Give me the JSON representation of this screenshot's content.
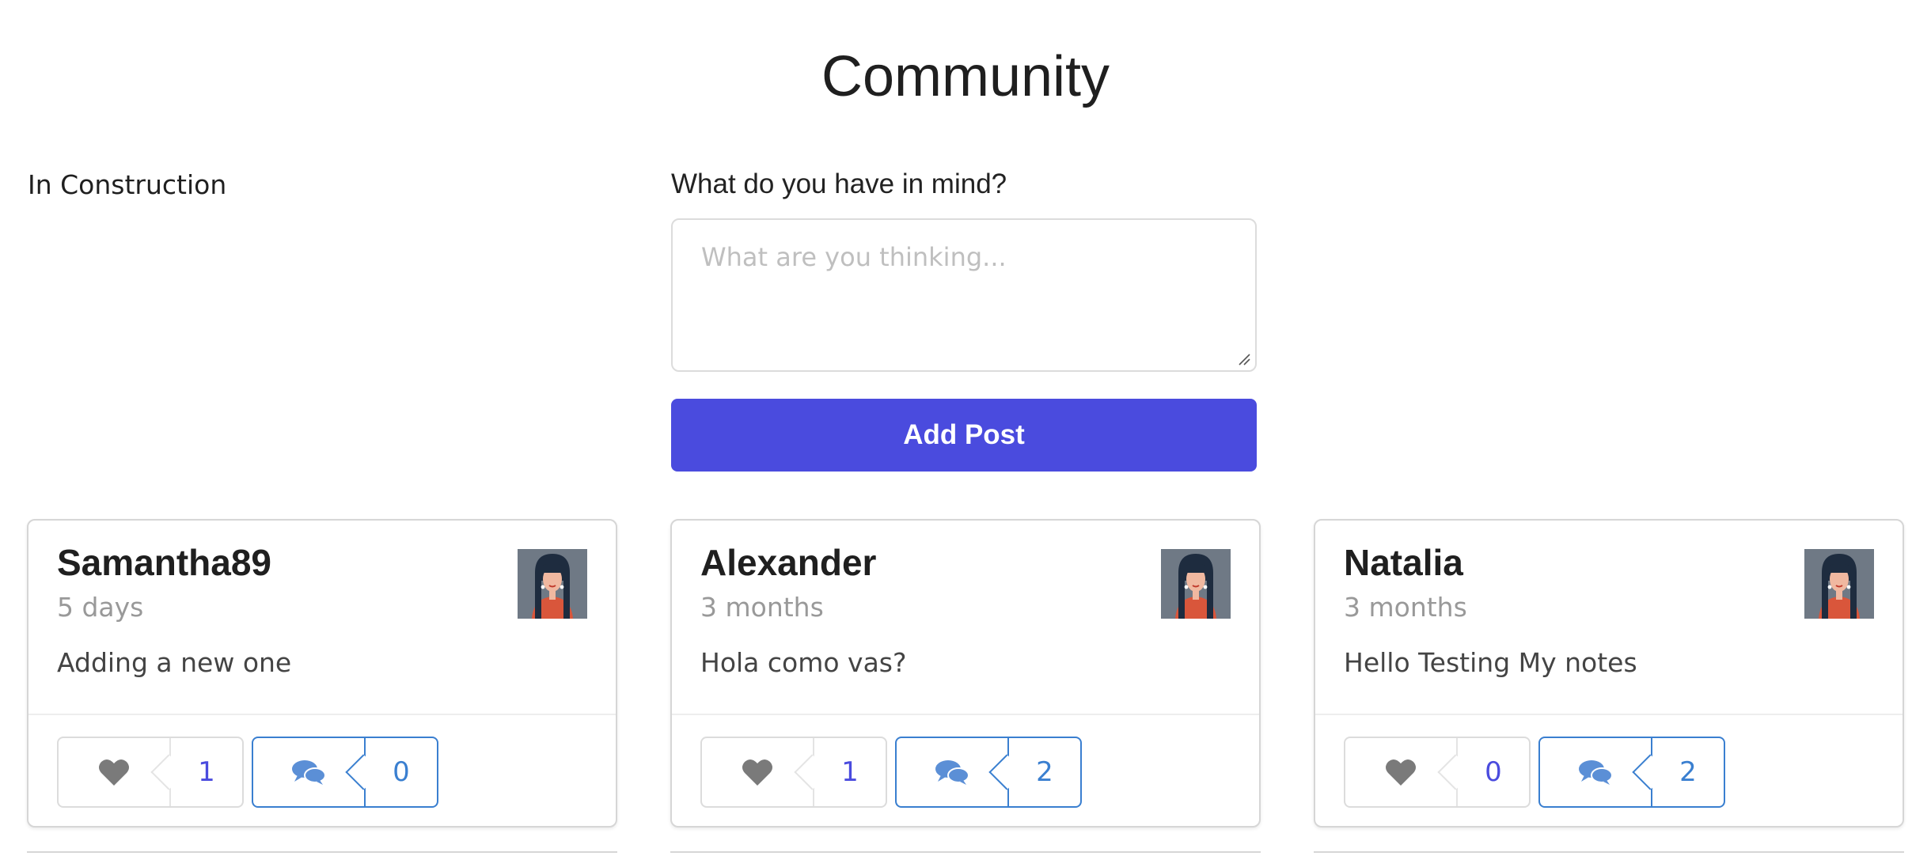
{
  "page": {
    "title": "Community",
    "left_status": "In Construction"
  },
  "composer": {
    "label": "What do you have in mind?",
    "placeholder": "What are you thinking...",
    "value": "",
    "button_label": "Add Post",
    "button_color": "#4a4bde"
  },
  "posts": [
    {
      "author": "Samantha89",
      "time": "5 days",
      "text": "Adding a new one",
      "likes": "1",
      "comments": "0",
      "avatar_icon": "woman-avatar-icon"
    },
    {
      "author": "Alexander",
      "time": "3 months",
      "text": "Hola como vas?",
      "likes": "1",
      "comments": "2",
      "avatar_icon": "woman-avatar-icon"
    },
    {
      "author": "Natalia",
      "time": "3 months",
      "text": "Hello Testing My notes",
      "likes": "0",
      "comments": "2",
      "avatar_icon": "woman-avatar-icon"
    }
  ],
  "icons": {
    "like": "heart-icon",
    "comment": "comments-icon"
  },
  "colors": {
    "accent": "#4a4bde",
    "comment_blue": "#3a7fd0",
    "muted": "#999999"
  }
}
